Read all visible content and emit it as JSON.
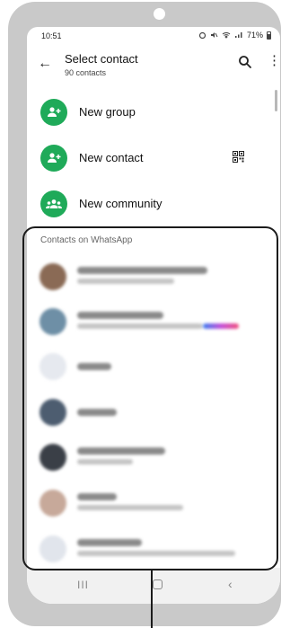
{
  "status_bar": {
    "time": "10:51",
    "battery": "71%"
  },
  "app_bar": {
    "title": "Select contact",
    "subtitle": "90 contacts"
  },
  "actions": [
    {
      "label": "New group",
      "icon": "group-add-icon"
    },
    {
      "label": "New contact",
      "icon": "person-add-icon",
      "trailing_icon": "qr-code-icon"
    },
    {
      "label": "New community",
      "icon": "community-icon"
    }
  ],
  "section": {
    "title": "Contacts on WhatsApp"
  },
  "contacts": [
    {
      "avatar_color": "#8a6a55"
    },
    {
      "avatar_color": "#6e8fa6"
    },
    {
      "avatar_color": "#e6e9ef"
    },
    {
      "avatar_color": "#4d5d70"
    },
    {
      "avatar_color": "#3a3f47"
    },
    {
      "avatar_color": "#c7a99a"
    },
    {
      "avatar_color": "#e1e5ec"
    }
  ],
  "colors": {
    "accent": "#1faa59",
    "frame": "#c9c9c9",
    "highlight": "#1b1b1b"
  }
}
